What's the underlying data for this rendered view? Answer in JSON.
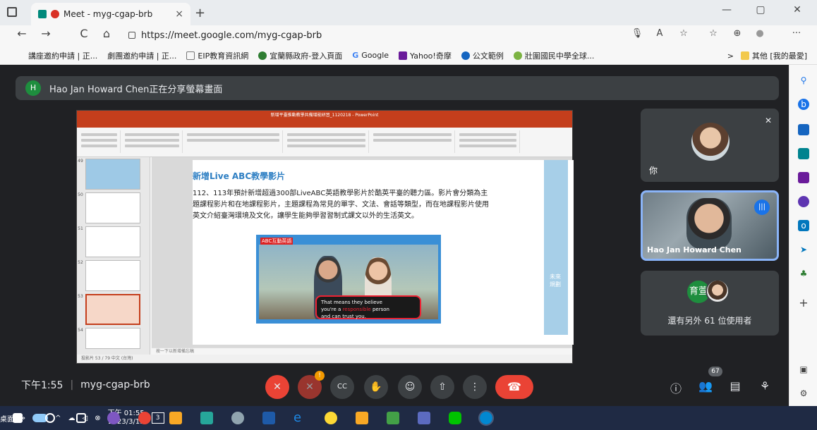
{
  "browser": {
    "tab_title": "Meet - myg-cgap-brb",
    "tab_close": "×",
    "new_tab": "+",
    "url": "https://meet.google.com/myg-cgap-brb",
    "window": {
      "minimize": "—",
      "maximize": "▢",
      "close": "✕"
    },
    "nav": {
      "back": "←",
      "forward": "→",
      "reload": "C",
      "home": "⌂"
    },
    "right_icons": {
      "read": "A",
      "favorite": "☆",
      "favorites": "☆",
      "collections": "⊕",
      "profile": "●",
      "more": "···"
    }
  },
  "bookmarks": {
    "items": [
      {
        "label": "講座邀約申請 | 正...",
        "color": ""
      },
      {
        "label": "劇團邀約申請 | 正...",
        "color": ""
      },
      {
        "label": "EIP教育資訊網",
        "color": "#888888"
      },
      {
        "label": "宜蘭縣政府-登入頁面",
        "color": "#2e7d32"
      },
      {
        "label": "Google",
        "color": "#4285f4"
      },
      {
        "label": "Yahoo!奇摩",
        "color": "#6a1b9a"
      },
      {
        "label": "公文範例",
        "color": "#1565c0"
      },
      {
        "label": "壯圍國民中學全球...",
        "color": "#7cb342"
      }
    ],
    "chevron": ">",
    "other_folder": "其他 [我的最愛]"
  },
  "meet": {
    "banner": {
      "avatar_letter": "H",
      "text": "Hao Jan Howard Chen正在分享螢幕畫面"
    },
    "tiles": {
      "you_label": "你",
      "host_name": "Hao Jan Howard Chen",
      "others_avatar": "育萱",
      "others_text": "還有另外 61 位使用者"
    },
    "bottom": {
      "time": "下午1:55",
      "separator": "|",
      "code": "myg-cgap-brb",
      "badge": "!",
      "people_count": "67",
      "icons": {
        "mic": "✕",
        "camera": "✕",
        "captions": "CC",
        "raise_hand": "✋",
        "emoji": "☺",
        "present": "⇧",
        "more": "⋮",
        "end": "☎",
        "info": "ⓘ",
        "people": "👥",
        "chat": "▤",
        "activities": "⚘"
      }
    }
  },
  "slide": {
    "app_title": "新增平臺推動教學共備增能研習_1120218 - PowerPoint",
    "heading": "新增Live ABC教學影片",
    "body": "112、113年預計新增超過300部LiveABC英語教學影片於酷英平臺的聽力區。影片會分類為主題課程影片和在地課程影片，主題課程為常見的單字、文法、會話等類型，而在地課程影片使用英文介紹臺灣環境及文化，讓學生能夠學習習制式課文以外的生活英文。",
    "video_brand": "ABC互動英語",
    "subtitle_1": "That means they believe",
    "subtitle_2a": "you're a",
    "subtitle_2b": "responsible",
    "subtitle_2c": "person",
    "subtitle_3": "and can trust you.",
    "stripe_text": "未來規劃",
    "notes": "按一下以新增備忘稿",
    "status": "投影片 53 / 79   中文 (台灣)",
    "thumb_numbers": [
      "49",
      "50",
      "51",
      "52",
      "53",
      "54"
    ]
  },
  "edge_sidebar": {
    "icons": [
      "search-icon",
      "bing-icon",
      "tag-icon",
      "toolbox-icon",
      "games-icon",
      "office-icon",
      "outlook-icon",
      "send-icon",
      "tree-icon",
      "add-icon"
    ],
    "add": "+"
  },
  "taskbar": {
    "desktop_label": "桌面",
    "chevron": "»",
    "clock_time": "下午 01:55",
    "clock_date": "2023/3/13",
    "notif_count": "3"
  }
}
